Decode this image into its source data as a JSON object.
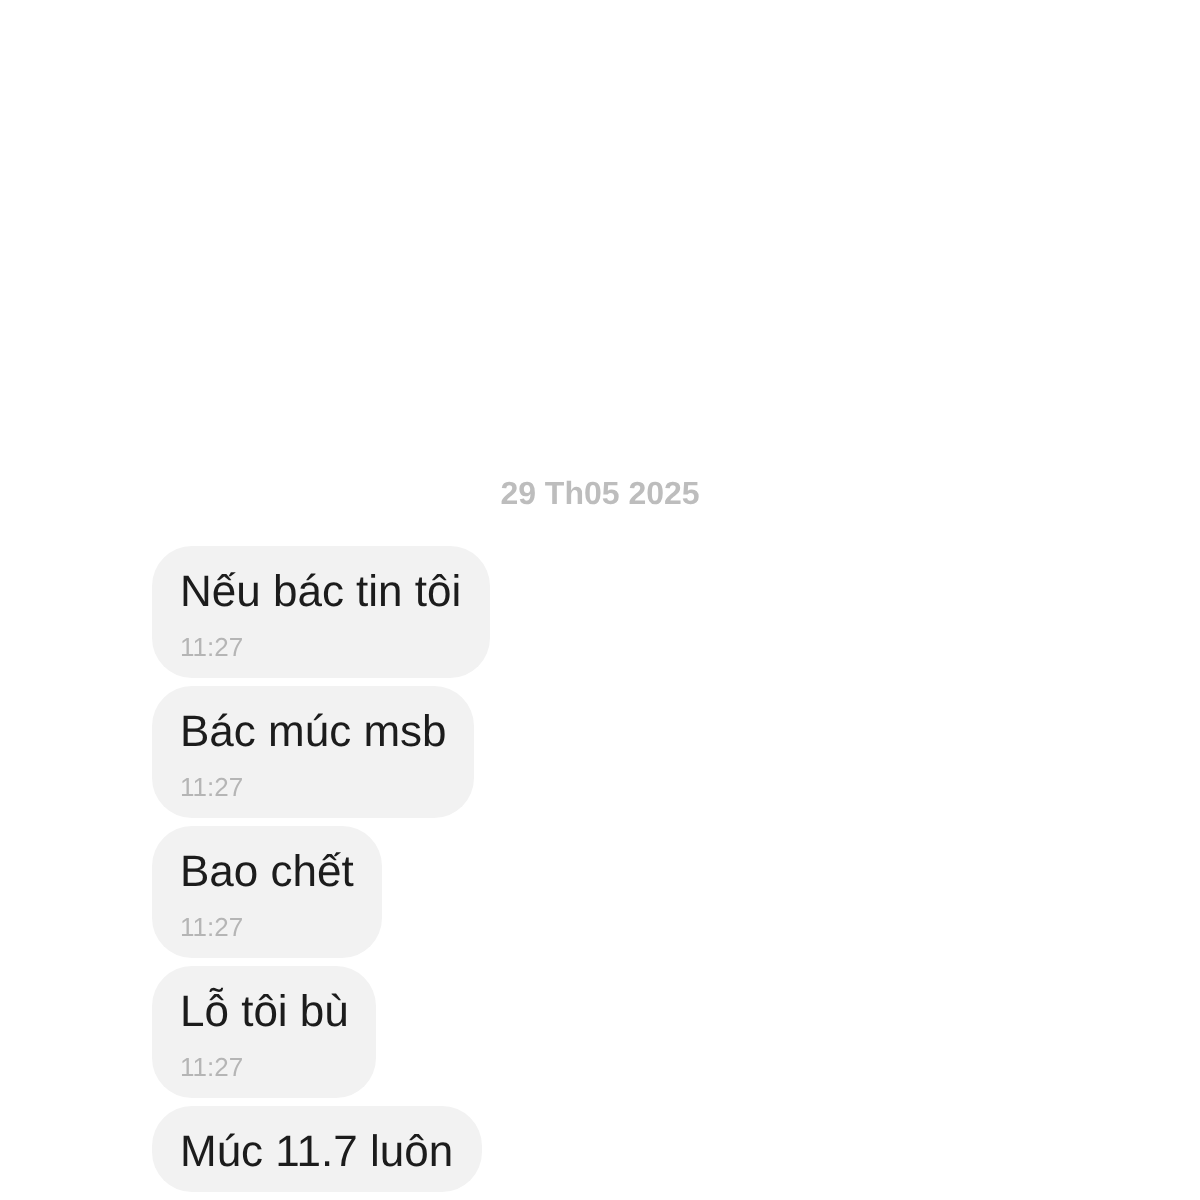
{
  "date_divider": "29 Th05 2025",
  "messages": [
    {
      "text": "Nếu bác tin tôi",
      "time": "11:27"
    },
    {
      "text": "Bác múc msb",
      "time": "11:27"
    },
    {
      "text": "Bao chết",
      "time": "11:27"
    },
    {
      "text": "Lỗ tôi bù",
      "time": "11:27"
    },
    {
      "text": "Múc 11.7 luôn"
    }
  ]
}
